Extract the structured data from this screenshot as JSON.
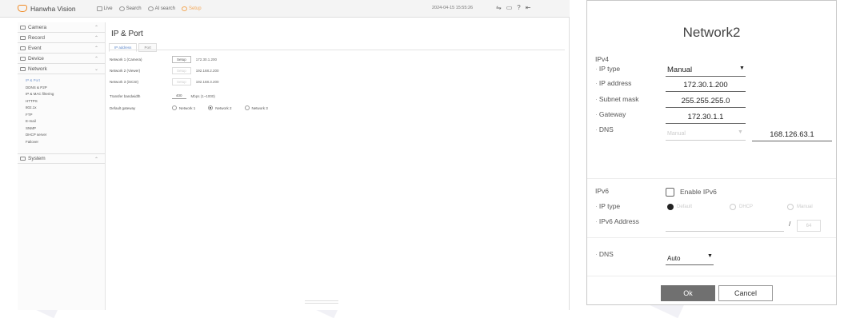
{
  "topbar": {
    "brand": "Hanwha Vision",
    "nav": [
      "Live",
      "Search",
      "AI search",
      "Setup"
    ],
    "datetime": "2024-04-15 15:55:26"
  },
  "sidebar": {
    "categories": [
      {
        "label": "Camera"
      },
      {
        "label": "Record"
      },
      {
        "label": "Event"
      },
      {
        "label": "Device"
      },
      {
        "label": "Network"
      }
    ],
    "network_items": [
      "IP & Port",
      "DDNS & P2P",
      "IP & MAC filtering",
      "HTTPS",
      "802.1x",
      "FTP",
      "E-mail",
      "SNMP",
      "DHCP server",
      "Failover"
    ],
    "system": "System"
  },
  "content": {
    "title": "IP & Port",
    "tabs": [
      "IP address",
      "Port"
    ],
    "rows": [
      {
        "label": "Network 1 (Camera)",
        "button": "Setup",
        "value": "172.30.1.200"
      },
      {
        "label": "Network 2 (Viewer)",
        "button": "Setup",
        "value": "192.168.2.200"
      },
      {
        "label": "Network 3 (iSCSI)",
        "button": "Setup",
        "value": "192.168.3.200"
      }
    ],
    "bandwidth": {
      "label": "Transfer bandwidth",
      "value": "400",
      "hint": "Mbps (1~1000)"
    },
    "gateway": {
      "label": "Default gateway",
      "options": [
        "Network 1",
        "Network 2",
        "Network 3"
      ],
      "selected": 1
    }
  },
  "dialog": {
    "title": "Network2",
    "ipv4_label": "IPv4",
    "ip_type_label": "IP type",
    "ip_type_value": "Manual",
    "ip_address_label": "IP address",
    "ip_address": "172.30.1.200",
    "subnet_label": "Subnet mask",
    "subnet": "255.255.255.0",
    "gateway_label": "Gateway",
    "gateway": "172.30.1.1",
    "dns_label": "DNS",
    "dns_mode": "Manual",
    "dns_value": "168.126.63.1",
    "ipv6_label": "IPv6",
    "enable_ipv6": "Enable IPv6",
    "ipv6_type_label": "IP type",
    "ipv6_options": [
      "Default",
      "DHCP",
      "Manual"
    ],
    "ipv6_address_label": "IPv6 Address",
    "ipv6_prefix": "/",
    "ipv6_prefix_value": "64",
    "ipv6_dns_label": "DNS",
    "ipv6_dns_value": "Auto",
    "ok": "Ok",
    "cancel": "Cancel"
  },
  "colors": {
    "accent": "#5b86c9",
    "ok_button": "#707070",
    "brand_orange": "#f08a24"
  }
}
